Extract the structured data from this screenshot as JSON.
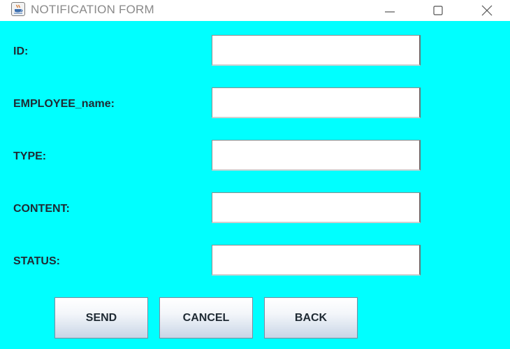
{
  "window": {
    "title": "NOTIFICATION FORM",
    "app_icon": "java-coffee-cup-icon",
    "controls": [
      "minimize-icon",
      "maximize-icon",
      "close-icon"
    ]
  },
  "form": {
    "background_color": "#00ffff",
    "fields": [
      {
        "label": "ID:",
        "value": ""
      },
      {
        "label": "EMPLOYEE_name:",
        "value": ""
      },
      {
        "label": "TYPE:",
        "value": ""
      },
      {
        "label": "CONTENT:",
        "value": ""
      },
      {
        "label": "STATUS:",
        "value": ""
      }
    ],
    "buttons": {
      "send": "SEND",
      "cancel": "CANCEL",
      "back": "BACK"
    }
  }
}
